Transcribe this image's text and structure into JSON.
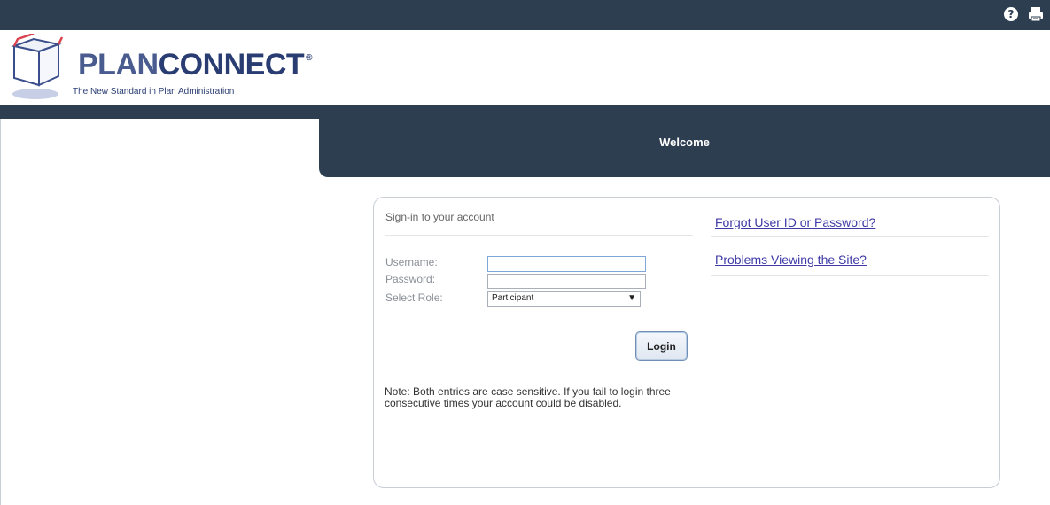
{
  "brand": {
    "name_part1": "PLAN",
    "name_part2": "CONNECT",
    "registered_mark": "®",
    "tagline": "The New Standard in Plan Administration"
  },
  "topbar": {
    "help_icon": "help-icon",
    "help_glyph": "?",
    "print_icon": "print-icon"
  },
  "welcome": {
    "title": "Welcome"
  },
  "signin": {
    "title": "Sign-in to your account",
    "username_label": "Username:",
    "password_label": "Password:",
    "role_label": "Select Role:",
    "username_value": "",
    "password_value": "",
    "role_selected": "Participant",
    "login_label": "Login",
    "note": "Note: Both entries are case sensitive. If you fail to login three consecutive times your account could be disabled."
  },
  "links": {
    "forgot": "Forgot User ID or Password?",
    "problems": "Problems Viewing the Site?"
  },
  "colors": {
    "header_navy": "#2e3e51",
    "link_blue": "#3e3aa6",
    "logo_blue": "#2a3d73"
  }
}
